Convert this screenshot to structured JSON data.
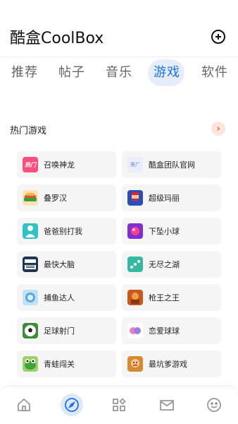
{
  "header": {
    "title": "酷盒CoolBox"
  },
  "tabs": [
    {
      "label": "推荐",
      "active": false
    },
    {
      "label": "帖子",
      "active": false
    },
    {
      "label": "音乐",
      "active": false
    },
    {
      "label": "游戏",
      "active": true
    },
    {
      "label": "软件",
      "active": false
    }
  ],
  "section": {
    "title": "热门游戏"
  },
  "games": [
    {
      "name": "召唤神龙",
      "icon": "dragon-icon",
      "icon_text": "热门"
    },
    {
      "name": "酷盒团队官网",
      "icon": "promo-icon",
      "icon_text": "推广"
    },
    {
      "name": "叠罗汉",
      "icon": "watermelon-icon"
    },
    {
      "name": "超级玛丽",
      "icon": "mario-icon"
    },
    {
      "name": "爸爸别打我",
      "icon": "dad-icon"
    },
    {
      "name": "下坠小球",
      "icon": "ball-fall-icon"
    },
    {
      "name": "最快大脑",
      "icon": "brain-icon"
    },
    {
      "name": "无尽之湖",
      "icon": "lake-icon"
    },
    {
      "name": "捕鱼达人",
      "icon": "fish-icon"
    },
    {
      "name": "枪王之王",
      "icon": "gunner-icon"
    },
    {
      "name": "足球射门",
      "icon": "soccer-icon"
    },
    {
      "name": "恋爱球球",
      "icon": "love-ball-icon"
    },
    {
      "name": "青蛙闯关",
      "icon": "frog-icon"
    },
    {
      "name": "最坑爹游戏",
      "icon": "troll-icon"
    }
  ],
  "colors": {
    "accent": "#1a73e8",
    "tab_bubble": "#dfeaf8",
    "section_arrow_bg": "#fde4dc",
    "section_arrow_fg": "#e6643c",
    "card_bg": "#f5f5f5"
  },
  "bottom_nav": [
    {
      "icon": "home-icon"
    },
    {
      "icon": "compass-icon",
      "active": true
    },
    {
      "icon": "apps-icon"
    },
    {
      "icon": "mail-icon"
    },
    {
      "icon": "smile-icon"
    }
  ]
}
